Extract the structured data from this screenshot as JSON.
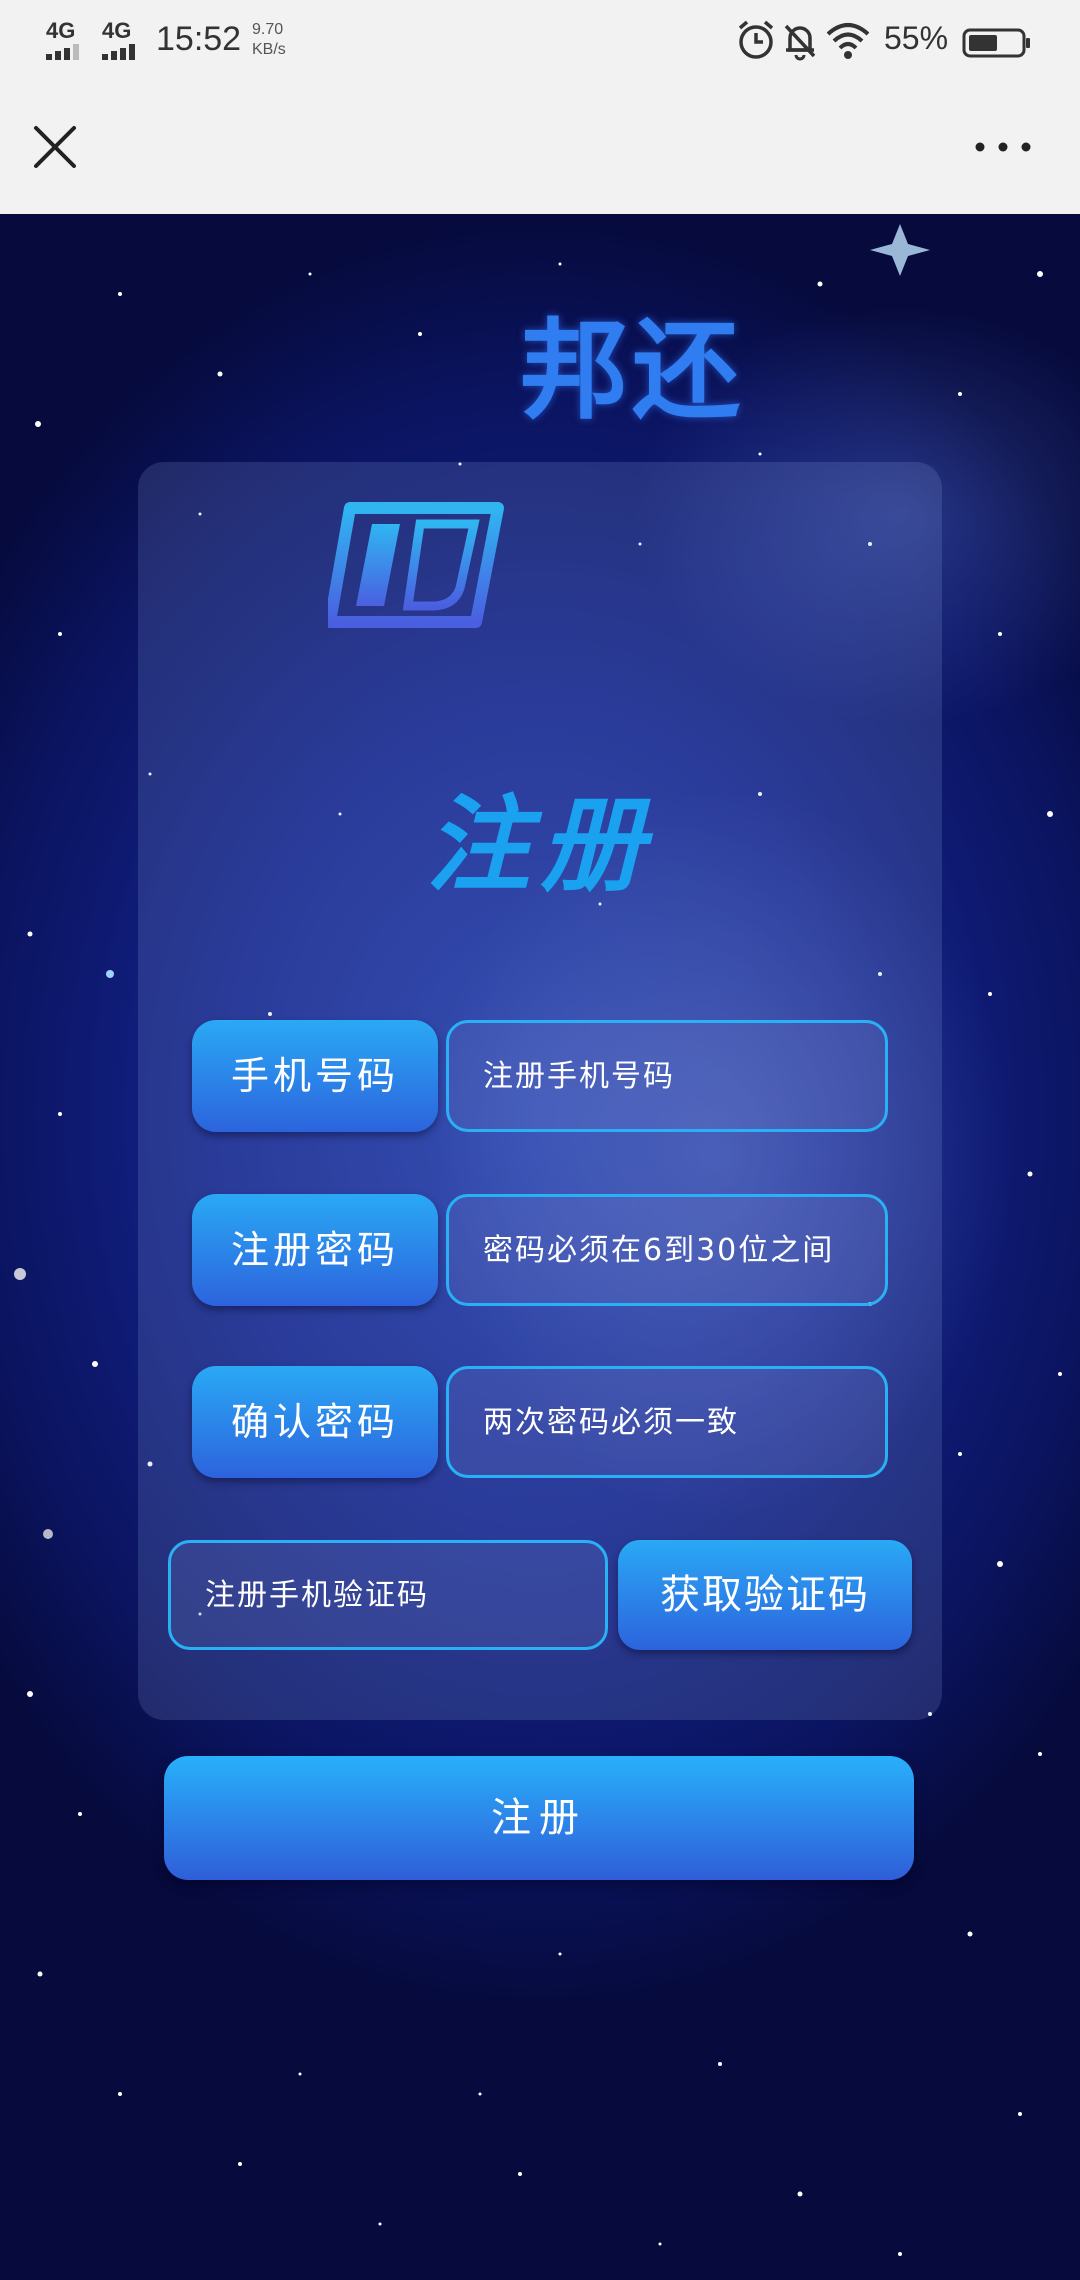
{
  "status_bar": {
    "signal1": "4G",
    "signal2": "4G",
    "time": "15:52",
    "speed_value": "9.70",
    "speed_unit": "KB/s",
    "battery_percent": "55%",
    "icons": [
      "alarm-icon",
      "mute-bell-icon",
      "wifi-icon",
      "battery-icon"
    ]
  },
  "title_bar": {
    "close_icon": "close-icon",
    "more_icon": "more-dots-icon"
  },
  "brand": {
    "name": "邦还",
    "color": "#2f7df0"
  },
  "form": {
    "title": "注册",
    "phone_label": "手机号码",
    "phone_placeholder": "注册手机号码",
    "password_label": "注册密码",
    "password_placeholder": "密码必须在6到30位之间",
    "confirm_label": "确认密码",
    "confirm_placeholder": "两次密码必须一致",
    "code_placeholder": "注册手机验证码",
    "code_button": "获取验证码",
    "submit_button": "注册"
  },
  "colors": {
    "accent": "#2aa9f5",
    "button_bottom": "#2c63dd",
    "background": "#13238a"
  }
}
